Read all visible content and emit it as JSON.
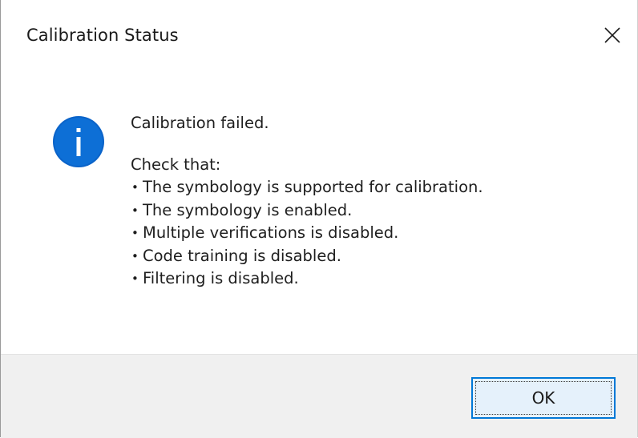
{
  "window": {
    "title": "Calibration Status",
    "close_icon": "close-x-icon"
  },
  "message": {
    "icon": "info-icon",
    "headline": "Calibration failed.",
    "intro": "Check that:",
    "bullet_glyph": "•",
    "items": [
      "The symbology is supported for calibration.",
      "The symbology is enabled.",
      "Multiple verifications is disabled.",
      "Code training is disabled.",
      "Filtering is disabled."
    ]
  },
  "buttons": {
    "ok_label": "OK"
  },
  "colors": {
    "accent": "#0078d7",
    "info_icon": "#0a63c9",
    "footer_bg": "#f0f0f0",
    "ok_bg": "#e5f1fb"
  }
}
